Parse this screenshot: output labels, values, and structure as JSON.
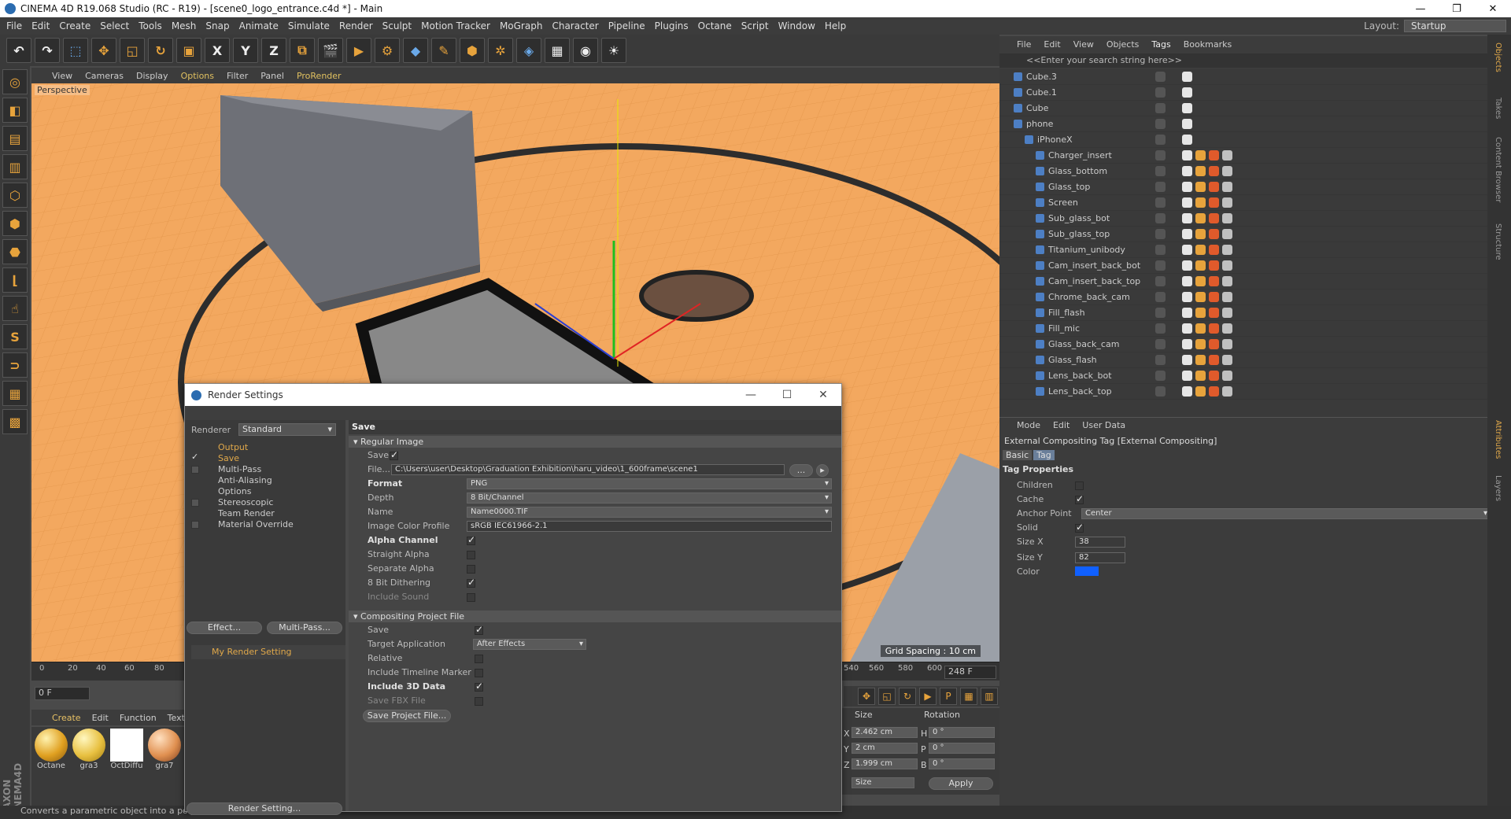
{
  "window": {
    "title": "CINEMA 4D R19.068 Studio (RC - R19) - [scene0_logo_entrance.c4d *] - Main"
  },
  "menubar": {
    "items": [
      "File",
      "Edit",
      "Create",
      "Select",
      "Tools",
      "Mesh",
      "Snap",
      "Animate",
      "Simulate",
      "Render",
      "Sculpt",
      "Motion Tracker",
      "MoGraph",
      "Character",
      "Pipeline",
      "Plugins",
      "Octane",
      "Script",
      "Window",
      "Help"
    ],
    "layout_label": "Layout:",
    "layout_value": "Startup"
  },
  "toolbar": {
    "icons": [
      "undo-icon",
      "redo-icon",
      "live-select-icon",
      "move-icon",
      "scale-icon",
      "rotate-icon",
      "recent-tool-icon",
      "x-axis-icon",
      "y-axis-icon",
      "z-axis-icon",
      "world-coord-icon",
      "render-view-icon",
      "render-picture-viewer-icon",
      "edit-render-settings-icon",
      "cube-icon",
      "pen-icon",
      "subdivision-icon",
      "cloner-icon",
      "deformer-icon",
      "floor-icon",
      "camera-icon",
      "light-icon"
    ],
    "axis_labels": [
      "X",
      "Y",
      "Z"
    ]
  },
  "viewport": {
    "menu": [
      "View",
      "Cameras",
      "Display",
      "Options",
      "Filter",
      "Panel",
      "ProRender"
    ],
    "label": "Perspective",
    "grid_spacing": "Grid Spacing : 10 cm"
  },
  "timeline": {
    "ticks": [
      "0",
      "20",
      "40",
      "60",
      "80"
    ],
    "ticks_right": [
      "540",
      "560",
      "580",
      "600"
    ],
    "start_frame": "0 F",
    "current_frame": "0 F",
    "end_frame": "248 F"
  },
  "materials": {
    "menu": [
      "Create",
      "Edit",
      "Function",
      "Textu"
    ],
    "items": [
      {
        "name": "Octane",
        "color": "#e0a020"
      },
      {
        "name": "gra3",
        "color": "#e8c040"
      },
      {
        "name": "OctDiffu",
        "color": "#ffffff"
      },
      {
        "name": "gra7",
        "color": "#e09050"
      }
    ]
  },
  "coord": {
    "header_size": "Size",
    "header_rotation": "Rotation",
    "rows": [
      {
        "axis": "X",
        "size": "2.462 cm",
        "rot_label": "H",
        "rot": "0 °"
      },
      {
        "axis": "Y",
        "size": "2 cm",
        "rot_label": "P",
        "rot": "0 °"
      },
      {
        "axis": "Z",
        "size": "1.999 cm",
        "rot_label": "B",
        "rot": "0 °"
      }
    ],
    "mode": "Size",
    "apply": "Apply"
  },
  "status": "Converts a parametric object into a polygonal object [Shortcut C]",
  "render_settings": {
    "title": "Render Settings",
    "renderer_label": "Renderer",
    "renderer": "Standard",
    "nav": [
      {
        "label": "Output",
        "check": false,
        "highlight": true
      },
      {
        "label": "Save",
        "check": true,
        "highlight": true
      },
      {
        "label": "Multi-Pass",
        "check": false,
        "box": true,
        "highlight": false
      },
      {
        "label": "Anti-Aliasing",
        "check": false,
        "highlight": false
      },
      {
        "label": "Options",
        "check": false,
        "highlight": false
      },
      {
        "label": "Stereoscopic",
        "check": false,
        "box": true,
        "highlight": false
      },
      {
        "label": "Team Render",
        "check": false,
        "highlight": false
      },
      {
        "label": "Material Override",
        "check": false,
        "box": true,
        "highlight": false
      }
    ],
    "effect_btn": "Effect...",
    "multipass_btn": "Multi-Pass...",
    "my_setting": "My Render Setting",
    "render_setting_btn": "Render Setting...",
    "panel_title": "Save",
    "regular_image": "Regular Image",
    "save_label": "Save",
    "file_label": "File...",
    "file_path": "C:\\Users\\user\\Desktop\\Graduation Exhibition\\haru_video\\1_600frame\\scene1",
    "file_btn": "...",
    "format_label": "Format",
    "format": "PNG",
    "depth_label": "Depth",
    "depth": "8 Bit/Channel",
    "name_label": "Name",
    "name": "Name0000.TIF",
    "profile_label": "Image Color Profile",
    "profile": "sRGB IEC61966-2.1",
    "options": [
      {
        "label": "Alpha Channel",
        "checked": true,
        "bold": true
      },
      {
        "label": "Straight Alpha",
        "checked": false,
        "bold": false
      },
      {
        "label": "Separate Alpha",
        "checked": false,
        "bold": false
      },
      {
        "label": "8 Bit Dithering",
        "checked": true,
        "bold": false
      },
      {
        "label": "Include Sound",
        "checked": false,
        "bold": false
      }
    ],
    "compositing": "Compositing Project File",
    "comp_save": "Save",
    "target_label": "Target Application",
    "target": "After Effects",
    "comp_options": [
      {
        "label": "Relative",
        "checked": false,
        "bold": false
      },
      {
        "label": "Include Timeline Marker",
        "checked": false,
        "bold": false
      },
      {
        "label": "Include 3D Data",
        "checked": true,
        "bold": true
      },
      {
        "label": "Save FBX File",
        "checked": false,
        "bold": false
      }
    ],
    "save_project_btn": "Save Project File..."
  },
  "object_manager": {
    "menu": [
      "File",
      "Edit",
      "View",
      "Objects",
      "Tags",
      "Bookmarks"
    ],
    "search_placeholder": "<<Enter your search string here>>",
    "objects": [
      {
        "name": "Cube.3",
        "indent": 0
      },
      {
        "name": "Cube.1",
        "indent": 0
      },
      {
        "name": "Cube",
        "indent": 0
      },
      {
        "name": "phone",
        "indent": 0
      },
      {
        "name": "iPhoneX",
        "indent": 1
      },
      {
        "name": "Charger_insert",
        "indent": 2
      },
      {
        "name": "Glass_bottom",
        "indent": 2
      },
      {
        "name": "Glass_top",
        "indent": 2
      },
      {
        "name": "Screen",
        "indent": 2
      },
      {
        "name": "Sub_glass_bot",
        "indent": 2
      },
      {
        "name": "Sub_glass_top",
        "indent": 2
      },
      {
        "name": "Titanium_unibody",
        "indent": 2
      },
      {
        "name": "Cam_insert_back_bot",
        "indent": 2
      },
      {
        "name": "Cam_insert_back_top",
        "indent": 2
      },
      {
        "name": "Chrome_back_cam",
        "indent": 2
      },
      {
        "name": "Fill_flash",
        "indent": 2
      },
      {
        "name": "Fill_mic",
        "indent": 2
      },
      {
        "name": "Glass_back_cam",
        "indent": 2
      },
      {
        "name": "Glass_flash",
        "indent": 2
      },
      {
        "name": "Lens_back_bot",
        "indent": 2
      },
      {
        "name": "Lens_back_top",
        "indent": 2
      }
    ]
  },
  "attributes": {
    "menu": [
      "Mode",
      "Edit",
      "User Data"
    ],
    "title": "External Compositing Tag [External Compositing]",
    "tabs": [
      "Basic",
      "Tag"
    ],
    "section": "Tag Properties",
    "children_label": "Children",
    "cache_label": "Cache",
    "anchor_label": "Anchor Point",
    "anchor": "Center",
    "solid_label": "Solid",
    "sizex_label": "Size X",
    "sizex": "38",
    "sizey_label": "Size Y",
    "sizey": "82",
    "color_label": "Color",
    "color": "#1060ff"
  },
  "right_tabs": [
    "Objects",
    "Takes",
    "Content Browser",
    "Structure",
    "Attributes",
    "Layers"
  ]
}
